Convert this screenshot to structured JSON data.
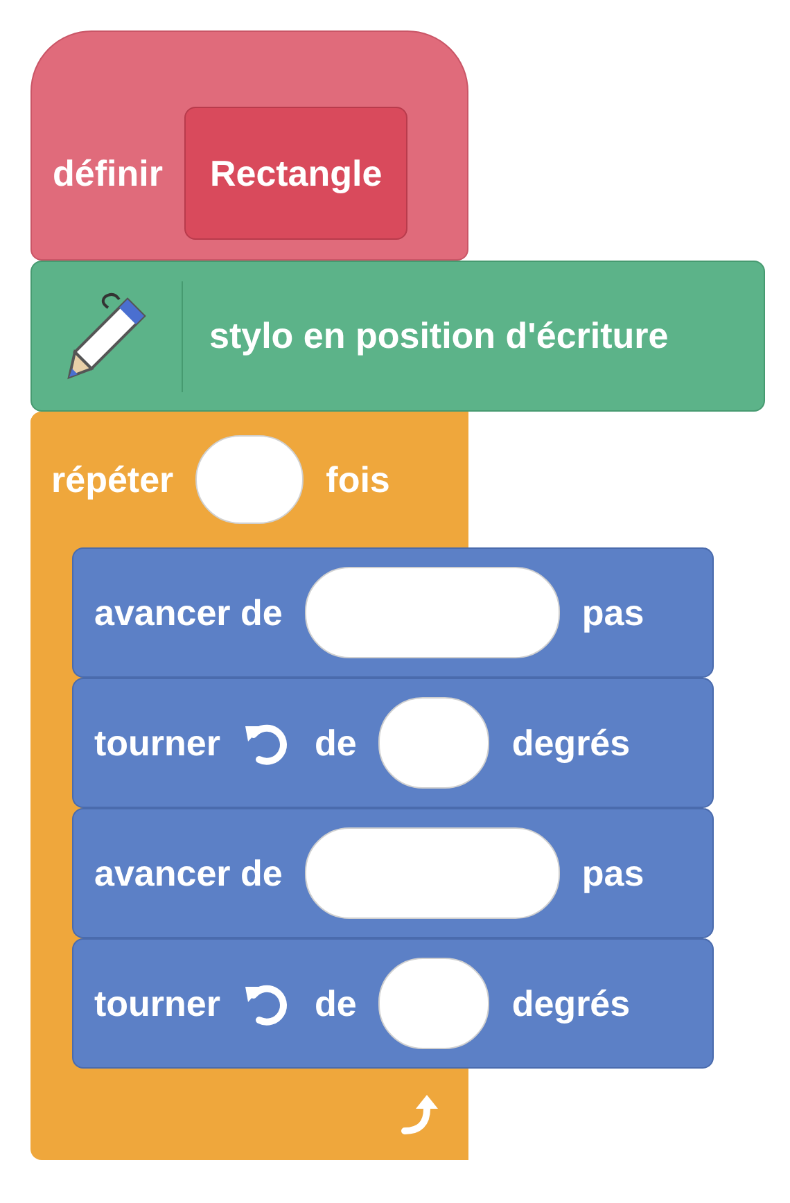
{
  "define_block": {
    "label": "définir",
    "name": "Rectangle"
  },
  "pen_block": {
    "label": "stylo en position d'écriture"
  },
  "repeat_block": {
    "label": "répéter",
    "unit": "fois",
    "children": [
      {
        "kind": "move",
        "label": "avancer de",
        "unit": "pas"
      },
      {
        "kind": "turn",
        "label": "tourner",
        "preposition": "de",
        "unit": "degrés"
      },
      {
        "kind": "move",
        "label": "avancer de",
        "unit": "pas"
      },
      {
        "kind": "turn",
        "label": "tourner",
        "preposition": "de",
        "unit": "degrés"
      }
    ]
  }
}
